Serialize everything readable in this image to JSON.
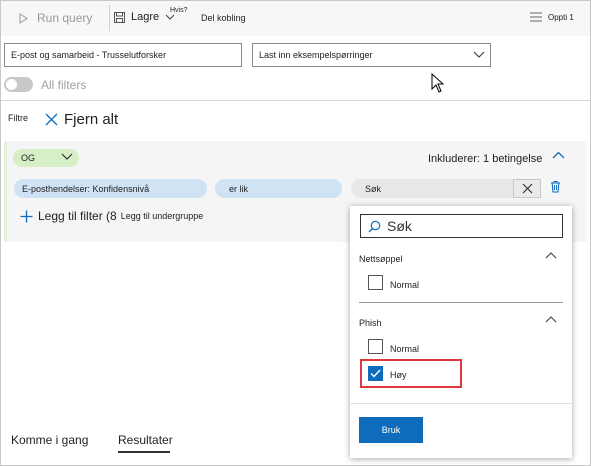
{
  "toolbar": {
    "run_query": "Run query",
    "save": "Lagre",
    "whats_this": "Hvis?",
    "share_link": "Del kobling",
    "update": "Oppti 1"
  },
  "query_select": {
    "value": "E-post og samarbeid - Trusselutforsker"
  },
  "sample_select": {
    "value": "Last inn eksempelspørringer"
  },
  "all_filters_label": "All filters",
  "filters": {
    "label": "Filtre",
    "clear_all": "Fjern alt",
    "logic_operator": "OG",
    "includes_text": "Inkluderer: 1 betingelse",
    "condition": {
      "field": "E-posthendelser: Konfidensnivå",
      "operator": "er lik",
      "value_placeholder": "Søk"
    },
    "add_filter": "Legg til filter (8",
    "add_subgroup": "Legg til undergruppe"
  },
  "dropdown": {
    "search_placeholder": "Søk",
    "groups": [
      {
        "name": "Nettsøppel",
        "options": [
          {
            "label": "Normal",
            "checked": false
          }
        ]
      },
      {
        "name": "Phish",
        "options": [
          {
            "label": "Normal",
            "checked": false
          },
          {
            "label": "Høy",
            "checked": true
          }
        ]
      }
    ],
    "apply_label": "Bruk"
  },
  "bottom_tabs": [
    "Komme i gang",
    "Resultater"
  ],
  "selected_tab": "Resultater",
  "colors": {
    "accent": "#0f6cbd",
    "highlight": "#e0383e",
    "og_pill": "#d6efc7",
    "condition_pill": "#cfe3f5"
  }
}
